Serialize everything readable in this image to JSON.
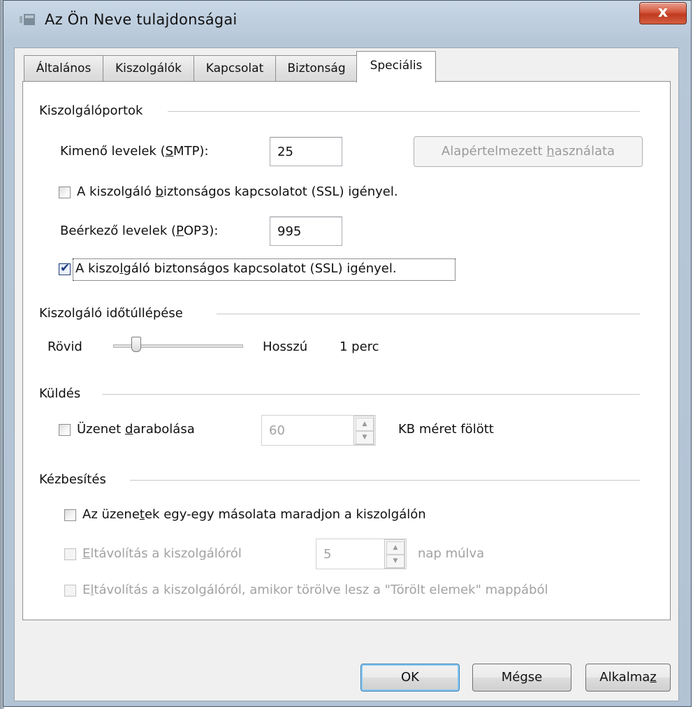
{
  "window": {
    "title": "Az Ön Neve tulajdonságai",
    "close_glyph": "x"
  },
  "tabs": [
    {
      "label": "Általános",
      "active": false
    },
    {
      "label": "Kiszolgálók",
      "active": false
    },
    {
      "label": "Kapcsolat",
      "active": false
    },
    {
      "label": "Biztonság",
      "active": false
    },
    {
      "label": "Speciális",
      "active": true
    }
  ],
  "ports": {
    "group_title": "Kiszolgálóportok",
    "outgoing_label_pre": "Kimenő levelek (",
    "outgoing_label_ul": "S",
    "outgoing_label_post": "MTP):",
    "outgoing_value": "25",
    "default_button": {
      "pre": "Alapértelmezett ",
      "ul": "h",
      "post": "asználata"
    },
    "ssl_outgoing": {
      "pre": "A kiszolgáló ",
      "ul": "b",
      "post": "iztonságos kapcsolatot (SSL) igényel.",
      "checked": false
    },
    "incoming_label_pre": "Beérkező levelek (",
    "incoming_label_ul": "P",
    "incoming_label_post": "OP3):",
    "incoming_value": "995",
    "ssl_incoming": {
      "pre": "A kiszo",
      "ul": "l",
      "post": "gáló biztonságos kapcsolatot (SSL) igényel.",
      "checked": true
    }
  },
  "timeout": {
    "group_title": "Kiszolgáló időtúllépése",
    "short_label": "Rövid",
    "long_label": "Hosszú",
    "value_label": "1 perc",
    "level": 0.15
  },
  "sending": {
    "group_title": "Küldés",
    "split": {
      "pre": "Üzenet ",
      "ul": "d",
      "post": "arabolása",
      "checked": false
    },
    "split_value": "60",
    "split_unit": "KB méret fölött"
  },
  "delivery": {
    "group_title": "Kézbesítés",
    "keep_copy": {
      "pre": "Az üzene",
      "ul": "t",
      "post": "ek egy-egy másolata maradjon a kiszolgálón",
      "checked": false
    },
    "remove_after": {
      "pre": "",
      "ul": "E",
      "post": "ltávolítás a kiszolgálóról",
      "checked": false
    },
    "remove_days": "5",
    "remove_days_unit": "nap múlva",
    "remove_on_delete": {
      "pre": "E",
      "ul": "l",
      "post": "távolítás a kiszolgálóról, amikor törölve lesz a \"Törölt elemek\" mappából",
      "checked": false
    }
  },
  "buttons": {
    "ok": "OK",
    "cancel": "Mégse",
    "apply_pre": "Alkalma",
    "apply_ul": "z"
  },
  "spin_glyphs": {
    "up": "▲",
    "down": "▼"
  },
  "check_glyph": "✔"
}
